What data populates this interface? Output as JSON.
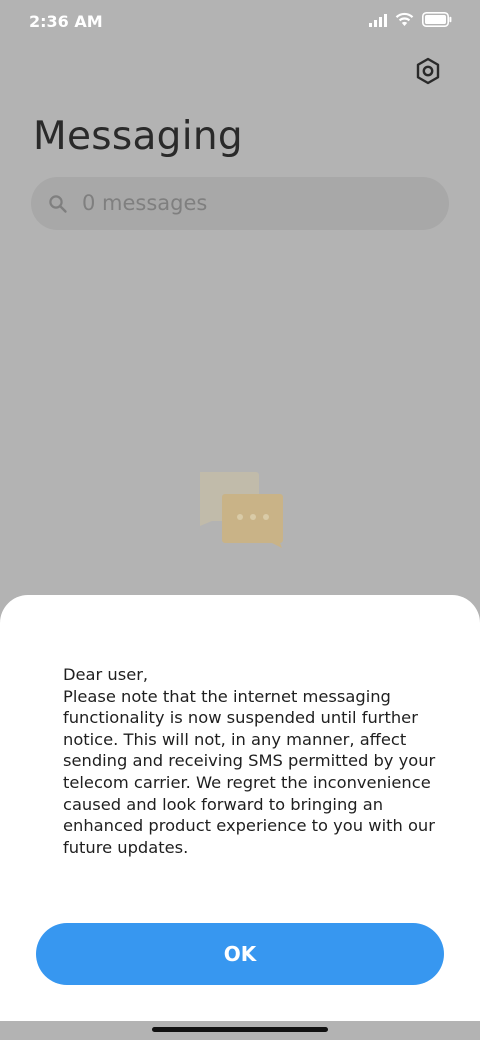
{
  "status_bar": {
    "time": "2:36 AM",
    "icons": [
      "signal-icon",
      "wifi-icon",
      "battery-icon"
    ]
  },
  "header": {
    "title": "Messaging",
    "settings_icon": "gear-icon"
  },
  "search": {
    "placeholder": "0 messages",
    "icon": "search-icon"
  },
  "empty_state": {
    "icon": "chat-bubbles-icon"
  },
  "dialog": {
    "greeting": "Dear user,",
    "body": "Please note that the internet messaging functionality is now suspended until further notice. This will not, in any manner, affect sending and receiving SMS permitted by your telecom carrier. We regret the inconvenience caused and look forward to bringing an enhanced product experience to you with our future updates.",
    "ok_label": "OK"
  },
  "colors": {
    "accent": "#3797f0",
    "overlay_background": "#b3b3b3",
    "dialog_background": "#ffffff"
  }
}
